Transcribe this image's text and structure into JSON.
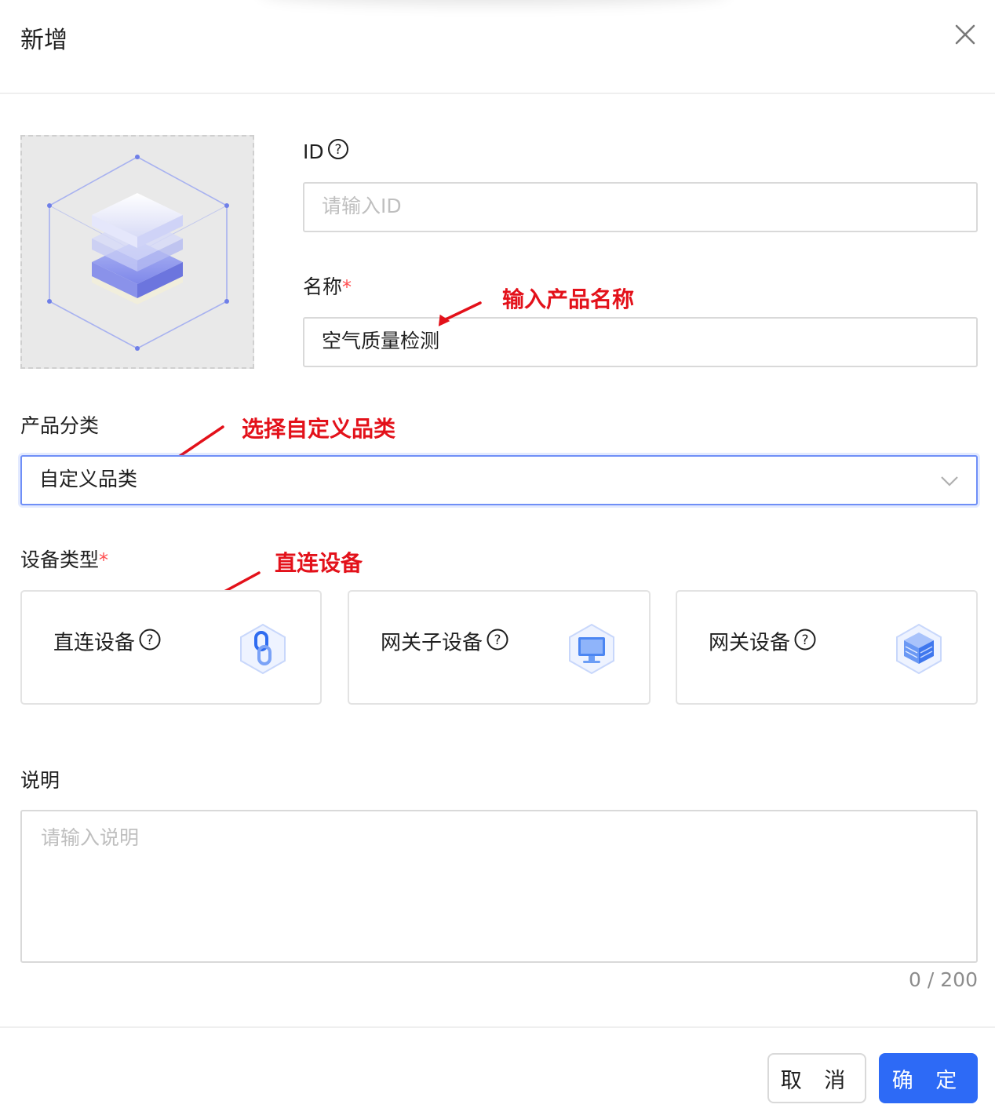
{
  "modal": {
    "title": "新增"
  },
  "form": {
    "id": {
      "label": "ID",
      "placeholder": "请输入ID"
    },
    "name": {
      "label": "名称",
      "required_mark": "*",
      "value": "空气质量检测"
    },
    "category": {
      "label": "产品分类",
      "value": "自定义品类"
    },
    "device_type": {
      "label": "设备类型",
      "required_mark": "*",
      "options": [
        {
          "label": "直连设备",
          "icon": "link-chain-icon"
        },
        {
          "label": "网关子设备",
          "icon": "monitor-icon"
        },
        {
          "label": "网关设备",
          "icon": "server-icon"
        }
      ]
    },
    "description": {
      "label": "说明",
      "placeholder": "请输入说明",
      "counter": "0 / 200"
    }
  },
  "annotations": {
    "name_hint": "输入产品名称",
    "category_hint": "选择自定义品类",
    "device_type_hint": "直连设备"
  },
  "footer": {
    "cancel_label": "取 消",
    "ok_label": "确 定"
  },
  "colors": {
    "primary": "#2d6af6",
    "required": "#ff4d4f",
    "annotation": "#e3111a"
  }
}
